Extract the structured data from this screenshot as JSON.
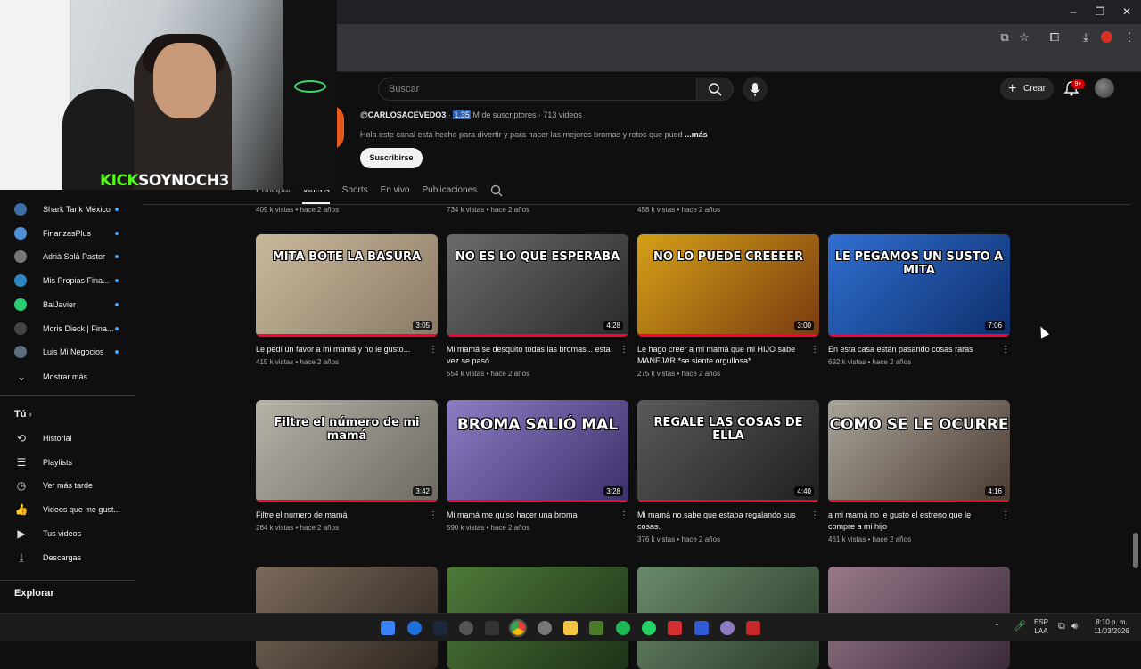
{
  "browser": {
    "window_controls": [
      "–",
      "❐",
      "✕"
    ]
  },
  "header": {
    "search_placeholder": "Buscar",
    "create_label": "Crear",
    "notifications_badge": "9+"
  },
  "channel": {
    "handle": "@CARLOSACEVEDO3",
    "subs_number": "1.35",
    "subs_suffix": " M de suscriptores · 713 videos",
    "description": "Hola este canal está hecho para divertir y para hacer las mejores bromas y retos que pued",
    "more_label": "...más",
    "subscribe_label": "Suscribirse",
    "tabs": [
      "Principal",
      "Videos",
      "Shorts",
      "En vivo",
      "Publicaciones"
    ],
    "active_tab": "Videos"
  },
  "webcam": {
    "kick_word": "KICK",
    "kick_handle": "SOYNOCH3"
  },
  "sidebar": {
    "subscriptions": [
      {
        "label": "Shark Tank México",
        "color": "#3a6ea5"
      },
      {
        "label": "FinanzasPlus",
        "color": "#4f8fd6"
      },
      {
        "label": "Adrià Solà Pastor",
        "color": "#777777"
      },
      {
        "label": "Mis Propias Fina...",
        "color": "#2e86c1"
      },
      {
        "label": "BaiJavier",
        "color": "#2ecc71"
      },
      {
        "label": "Moris Dieck | Fina...",
        "color": "#444444"
      },
      {
        "label": "Luis Mi Negocios",
        "color": "#5d6d7e"
      }
    ],
    "show_more": "Mostrar más",
    "you_heading": "Tú",
    "you_items": [
      {
        "label": "Historial",
        "icon": "history-icon",
        "glyph": "⟲"
      },
      {
        "label": "Playlists",
        "icon": "playlists-icon",
        "glyph": "☰"
      },
      {
        "label": "Ver más tarde",
        "icon": "clock-icon",
        "glyph": "◷"
      },
      {
        "label": "Videos que me gust...",
        "icon": "thumbs-up-icon",
        "glyph": "👍"
      },
      {
        "label": "Tus videos",
        "icon": "your-videos-icon",
        "glyph": "▶"
      },
      {
        "label": "Descargas",
        "icon": "download-icon",
        "glyph": "⤓"
      }
    ],
    "explore_heading": "Explorar"
  },
  "previous_row_meta": [
    "409 k vistas • hace 2 años",
    "734 k vistas • hace 2 años",
    "458 k vistas • hace 2 años"
  ],
  "videos": [
    {
      "thumb_text": "MITA BOTE LA BASURA",
      "duration": "3:05",
      "title": "Le pedí un favor a mi mamá y no le gusto...",
      "meta": "415 k vistas • hace 2 años",
      "bg": "linear-gradient(135deg,#c9b99b,#8a7a66)"
    },
    {
      "thumb_text": "NO ES LO QUE ESPERABA",
      "duration": "4:28",
      "title": "Mi mamá se desquitó todas las bromas... esta vez se pasó",
      "meta": "554 k vistas • hace 2 años",
      "bg": "linear-gradient(135deg,#6b6b6b,#2a2a2a)"
    },
    {
      "thumb_text": "NO LO PUEDE CREEEER",
      "duration": "3:00",
      "title": "Le hago creer a mi mamá que mi HIJO sabe MANEJAR *se siente orgullosa*",
      "meta": "275 k vistas • hace 2 años",
      "bg": "linear-gradient(135deg,#d4a017,#7a3b10)"
    },
    {
      "thumb_text": "LE PEGAMOS UN SUSTO A MITA",
      "duration": "7:06",
      "title": "En esta casa están pasando cosas raras",
      "meta": "692 k vistas • hace 2 años",
      "bg": "linear-gradient(135deg,#2f6fd1,#0e2e6b)"
    },
    {
      "thumb_text": "Filtre el número de mi mamá",
      "duration": "3:42",
      "title": "Filtre el numero de mamá",
      "meta": "264 k vistas • hace 2 años",
      "bg": "linear-gradient(135deg,#b6b2a8,#6d6a62)"
    },
    {
      "thumb_text": "BROMA SALIÓ MAL",
      "duration": "3:28",
      "title": "Mi mamá me quiso hacer una broma",
      "meta": "590 k vistas • hace 2 años",
      "bg": "linear-gradient(135deg,#8e7cc3,#3c2f6b)"
    },
    {
      "thumb_text": "REGALE LAS COSAS DE ELLA",
      "duration": "4:40",
      "title": "Mi mamá no sabe que estaba regalando sus cosas.",
      "meta": "376 k vistas • hace 2 años",
      "bg": "linear-gradient(135deg,#5a5a5a,#1f1f1f)"
    },
    {
      "thumb_text": "COMO SE LE OCURRE",
      "duration": "4:16",
      "title": "a mi mamá no le gusto el estreno que le compre a mi hijo",
      "meta": "461 k vistas • hace 2 años",
      "bg": "linear-gradient(135deg,#a8a39a,#4a3a30)"
    },
    {
      "bg": "linear-gradient(135deg,#7a6a5a,#2e2620)"
    },
    {
      "bg": "linear-gradient(135deg,#4f7a3a,#1d3318)"
    },
    {
      "bg": "linear-gradient(135deg,#6a8a6a,#2a3a2a)"
    },
    {
      "bg": "linear-gradient(135deg,#9a7a8a,#3a2a3a)"
    }
  ],
  "taskbar": {
    "lang": "ESP",
    "lang2": "LAA",
    "time": "8:10 p. m.",
    "date": "11/03/2026"
  }
}
